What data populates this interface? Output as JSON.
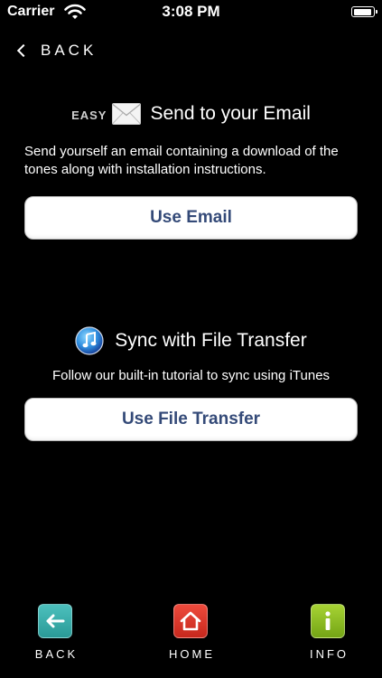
{
  "status_bar": {
    "carrier": "Carrier",
    "time": "3:08 PM",
    "battery_level": 0.95
  },
  "nav": {
    "back_label": "BACK"
  },
  "email_section": {
    "badge": "EASY",
    "icon": "envelope-icon",
    "title": "Send to your Email",
    "description": "Send yourself an email containing a download of the tones along with installation instructions.",
    "button_label": "Use Email"
  },
  "transfer_section": {
    "icon": "itunes-icon",
    "title": "Sync with File Transfer",
    "description": "Follow our built-in tutorial to sync using iTunes",
    "button_label": "Use File Transfer"
  },
  "tab_bar": {
    "items": [
      {
        "label": "BACK",
        "icon": "back-arrow-icon",
        "color": "#2fa5a2"
      },
      {
        "label": "HOME",
        "icon": "home-icon",
        "color": "#d9342a"
      },
      {
        "label": "INFO",
        "icon": "info-icon",
        "color": "#8dbd22"
      }
    ]
  }
}
